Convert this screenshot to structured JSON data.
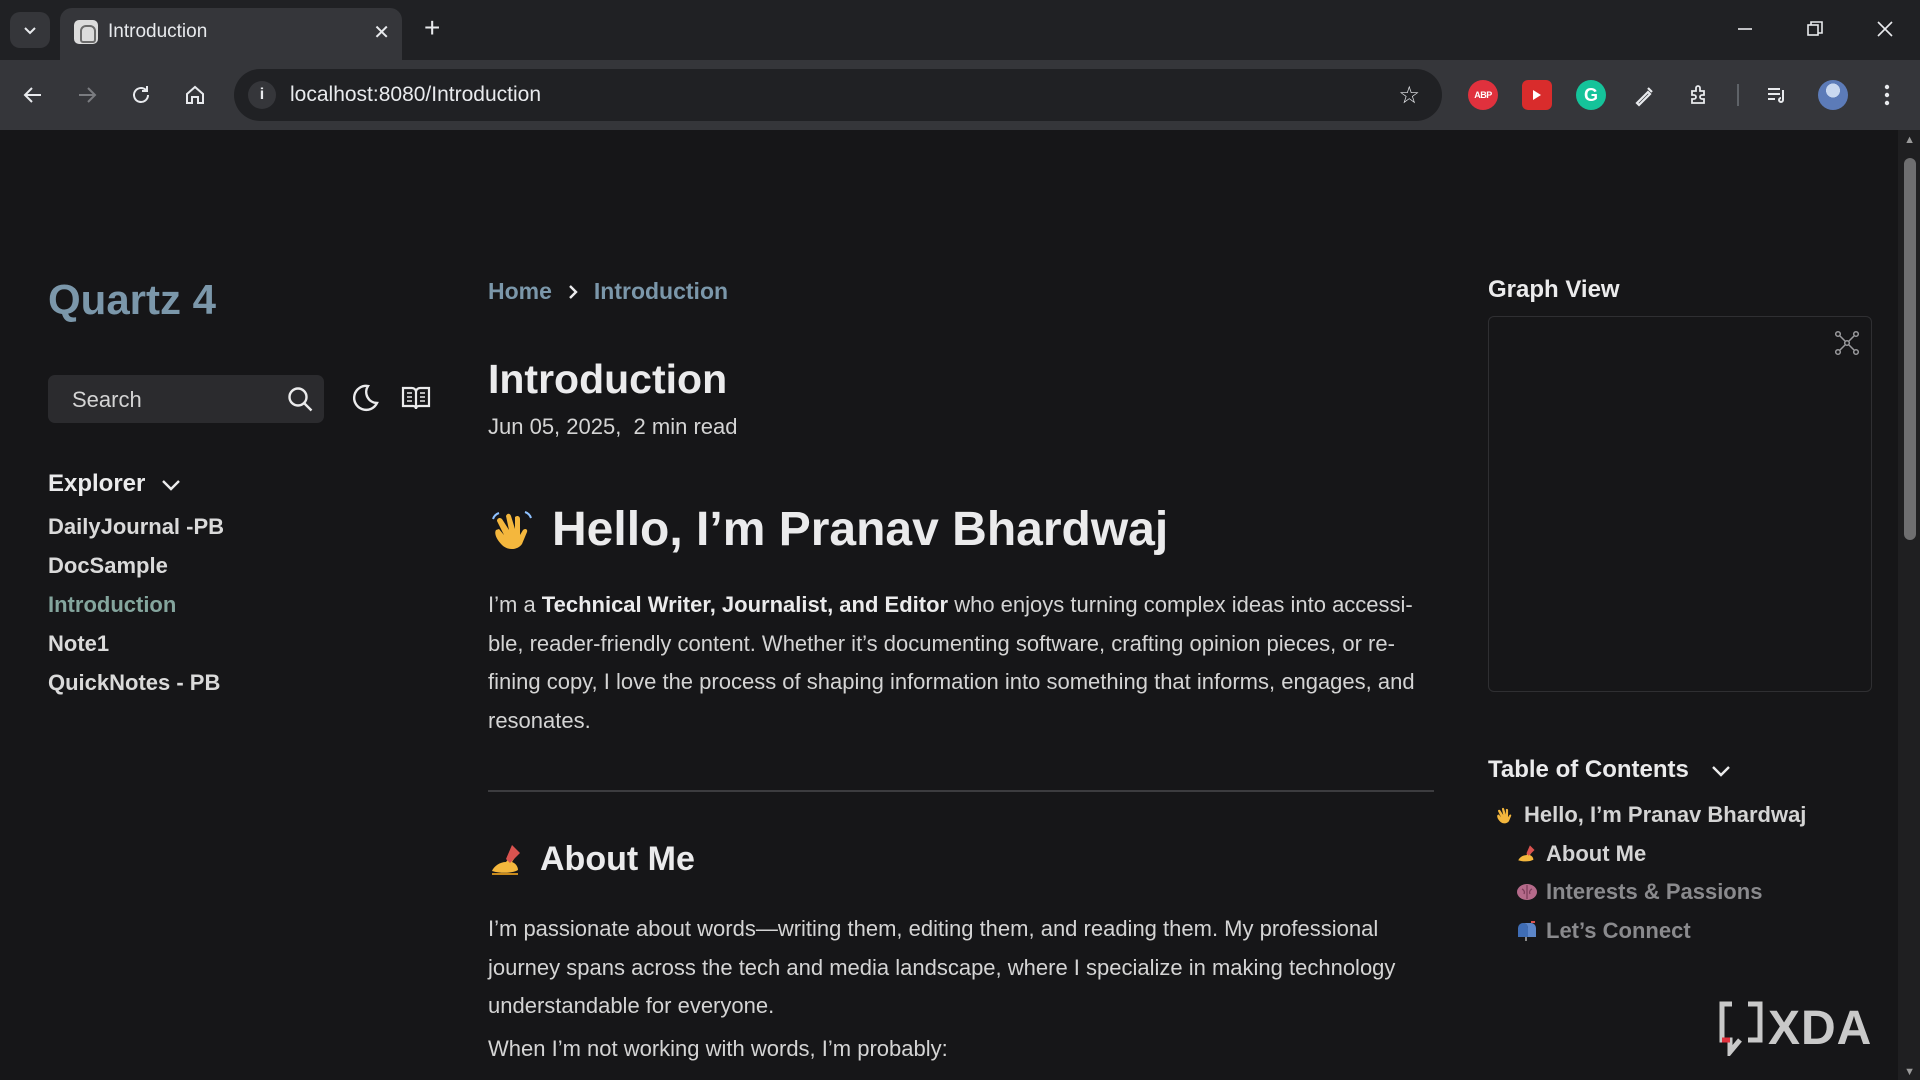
{
  "browser": {
    "tab_title": "Introduction",
    "url": "localhost:8080/Introduction",
    "extensions": {
      "abp_label": "ABP",
      "grammarly_label": "G"
    }
  },
  "sidebar": {
    "site_title": "Quartz 4",
    "search_label": "Search",
    "explorer_title": "Explorer",
    "items": [
      {
        "label": "DailyJournal -PB"
      },
      {
        "label": "DocSample"
      },
      {
        "label": "Introduction"
      },
      {
        "label": "Note1"
      },
      {
        "label": "QuickNotes - PB"
      }
    ]
  },
  "main": {
    "breadcrumb": {
      "home": "Home",
      "current": "Introduction"
    },
    "title": "Introduction",
    "meta": "Jun 05, 2025,  2 min read",
    "h1": "Hello, I’m Pranav Bhardwaj",
    "intro_pre": "I’m a ",
    "intro_bold": "Technical Writer, Journalist, and Editor",
    "intro_post": " who enjoys turning complex ideas into accessi-ble, reader-friendly content. Whether it’s documenting software, crafting opinion pieces, or re-fining copy, I love the process of shaping information into something that informs, engages, and resonates.",
    "h2_about": "About Me",
    "about_para": "I’m passionate about words—writing them, editing them, and reading them. My professional journey spans across the tech and media landscape, where I specialize in making technology understandable for everyone.",
    "next_para": "When I’m not working with words, I’m probably:"
  },
  "right": {
    "graph_title": "Graph View",
    "toc_title": "Table of Contents",
    "toc": [
      {
        "label": "Hello, I’m Pranav Bhardwaj"
      },
      {
        "label": "About Me"
      },
      {
        "label": "Interests & Passions"
      },
      {
        "label": "Let’s Connect"
      }
    ]
  },
  "watermark": "XDA",
  "colors": {
    "accent_secondary": "#7b97aa",
    "accent_tertiary": "#84a59d",
    "background": "#161618",
    "text": "#d4d4d4"
  }
}
